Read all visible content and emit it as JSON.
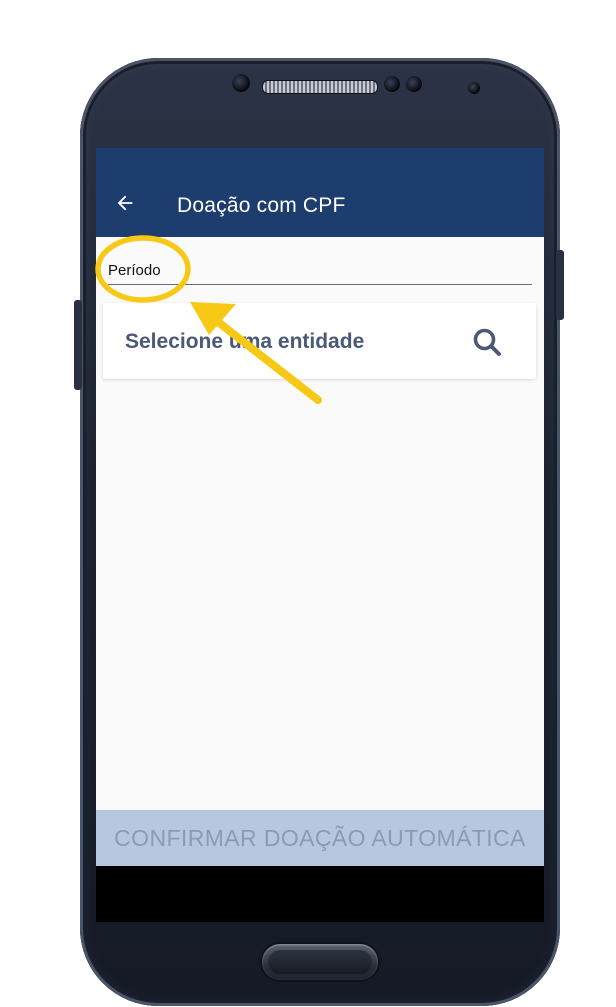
{
  "appbar": {
    "title": "Doação com CPF",
    "back_icon": "arrow-back-icon"
  },
  "form": {
    "period_label": "Período",
    "entity_placeholder": "Selecione uma entidade",
    "search_icon": "search-icon"
  },
  "footer": {
    "confirm_label": "CONFIRMAR DOAÇÃO AUTOMÁTICA"
  },
  "colors": {
    "appbar": "#1c3d6e",
    "content_bg": "#fafafa",
    "entity_text": "#4b5876",
    "confirm_bg": "#b7c7df",
    "confirm_text": "#8a9bb5",
    "annotation": "#f7c816"
  }
}
